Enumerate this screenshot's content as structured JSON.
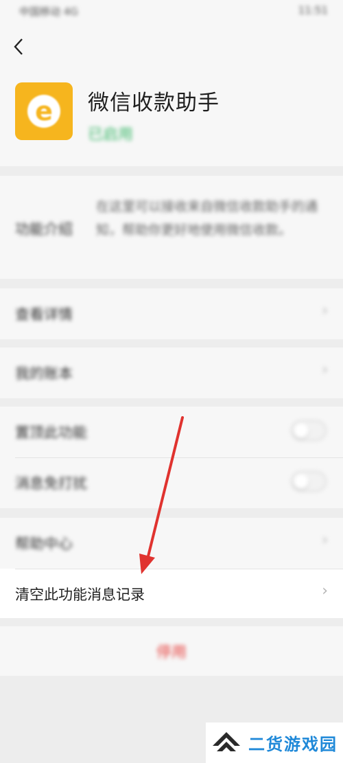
{
  "status_bar": {
    "carrier": "中国移动 4G",
    "time": "11:51"
  },
  "header": {
    "back_icon": "chevron-left-icon"
  },
  "profile": {
    "name": "微信收款助手",
    "status": "已启用",
    "status_color": "#3cb86a",
    "icon_color": "#f6b51e"
  },
  "description": {
    "label": "功能介绍",
    "text": "在这里可以接收来自微信收款助手的通知，帮助你更好地使用微信收款。"
  },
  "menu": {
    "view_details": "查看详情",
    "my_account": "我的账本",
    "pin_feature": "置顶此功能",
    "do_not_disturb": "消息免打扰",
    "help_center": "帮助中心",
    "clear_records": "清空此功能消息记录"
  },
  "stop_button": {
    "label": "停用",
    "color": "#e64340"
  },
  "annotation": {
    "arrow_color": "#e0332f"
  },
  "watermark": {
    "text": "二货游戏园"
  }
}
